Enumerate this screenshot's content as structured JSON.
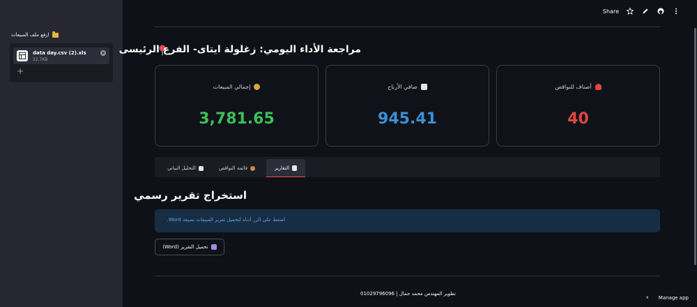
{
  "sidebar": {
    "uploader_label": "ارفع ملف المبيعات",
    "file": {
      "name": "data day.csv (2).xls",
      "size": "22.7KB"
    }
  },
  "topbar": {
    "share_label": "Share"
  },
  "main": {
    "title": "مراجعة الأداء اليومي: زغلولة ايتاى- الفرع الرئيسى",
    "metrics": [
      {
        "label": "إجمالي المبيعات",
        "value": "3,781.65",
        "color": "#3dbd5a",
        "icon": "money-bag-icon"
      },
      {
        "label": "صافي الأرباح",
        "value": "945.41",
        "color": "#3c8fd4",
        "icon": "chart-up-icon"
      },
      {
        "label": "أصناف للنواقص",
        "value": "40",
        "color": "#e2463e",
        "icon": "alarm-icon"
      }
    ],
    "tabs": [
      {
        "label": "التقارير",
        "icon": "document-icon",
        "active": true
      },
      {
        "label": "قائمة النواقص",
        "icon": "cookie-icon",
        "active": false
      },
      {
        "label": "التحليل البياني",
        "icon": "chart-icon",
        "active": false
      }
    ],
    "section_title": "استخراج تقرير رسمي",
    "info_text": "اضغط على الزر أدناه لتحميل تقرير المبيعات بصيغة Word.",
    "download_label": "تحميل التقرير (Word)"
  },
  "footer": {
    "credit": "تطوير المهندس محمد جمال | 01029796096",
    "manage_app": "Manage app"
  }
}
